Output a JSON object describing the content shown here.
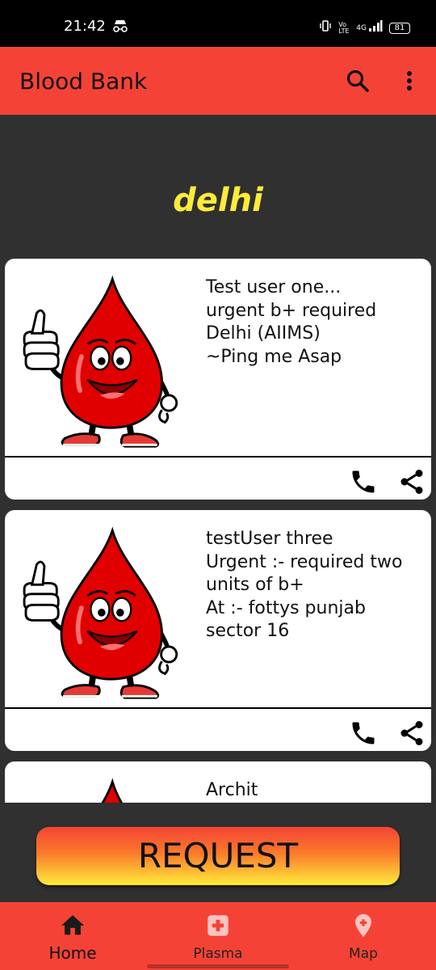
{
  "status_bar": {
    "time": "21:42",
    "network_label": "4G",
    "volte_label": "Vo LTE",
    "battery_level": "81"
  },
  "app_bar": {
    "title": "Blood Bank",
    "icons": [
      "search-icon",
      "more-vert-icon"
    ]
  },
  "city": "delhi",
  "posts": [
    {
      "text": "Test user one...\nurgent b+ required\nDelhi (AIIMS)\n~Ping me Asap"
    },
    {
      "text": "testUser three\nUrgent :- required two units of b+\nAt :- fottys punjab sector 16"
    },
    {
      "text": "Archit"
    }
  ],
  "request_button": "REQUEST",
  "bottom_nav": [
    {
      "label": "Home",
      "icon": "home-icon"
    },
    {
      "label": "Plasma",
      "icon": "medical-cross-icon"
    },
    {
      "label": "Map",
      "icon": "map-pin-icon"
    }
  ],
  "colors": {
    "primary": "#f44336",
    "accent": "#ffeb3b",
    "background": "#303030"
  }
}
